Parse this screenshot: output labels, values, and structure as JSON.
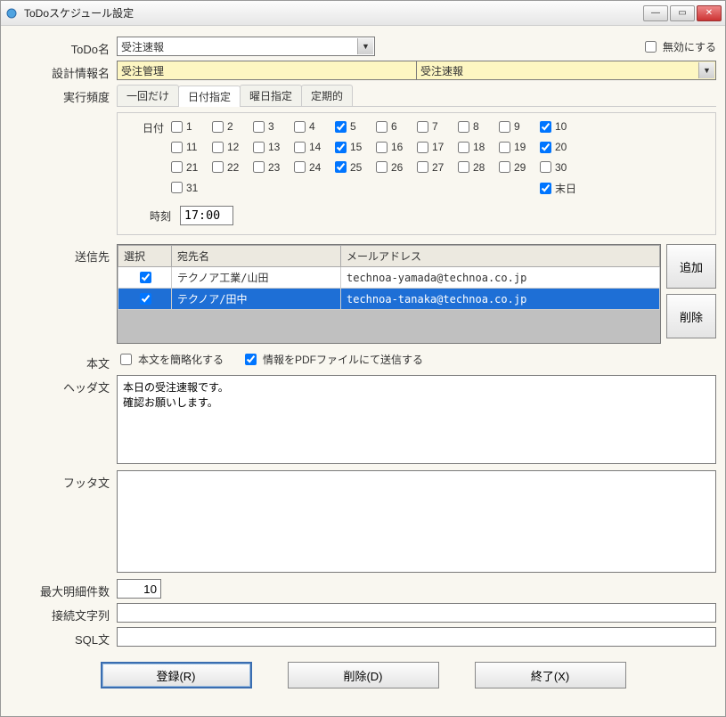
{
  "window": {
    "title": "ToDoスケジュール設定",
    "icon": "todo-icon"
  },
  "fields": {
    "todo_name_label": "ToDo名",
    "todo_name_value": "受注速報",
    "disable_label": "無効にする",
    "disable_checked": false,
    "design_info_label": "設計情報名",
    "design_info_left": "受注管理",
    "design_info_right": "受注速報",
    "frequency_label": "実行頻度",
    "tabs": [
      {
        "label": "一回だけ"
      },
      {
        "label": "日付指定"
      },
      {
        "label": "曜日指定"
      },
      {
        "label": "定期的"
      }
    ],
    "active_tab": 1,
    "date_sub_label": "日付",
    "dates": [
      {
        "n": 1,
        "c": false
      },
      {
        "n": 2,
        "c": false
      },
      {
        "n": 3,
        "c": false
      },
      {
        "n": 4,
        "c": false
      },
      {
        "n": 5,
        "c": true
      },
      {
        "n": 6,
        "c": false
      },
      {
        "n": 7,
        "c": false
      },
      {
        "n": 8,
        "c": false
      },
      {
        "n": 9,
        "c": false
      },
      {
        "n": 10,
        "c": true
      },
      {
        "n": 11,
        "c": false
      },
      {
        "n": 12,
        "c": false
      },
      {
        "n": 13,
        "c": false
      },
      {
        "n": 14,
        "c": false
      },
      {
        "n": 15,
        "c": true
      },
      {
        "n": 16,
        "c": false
      },
      {
        "n": 17,
        "c": false
      },
      {
        "n": 18,
        "c": false
      },
      {
        "n": 19,
        "c": false
      },
      {
        "n": 20,
        "c": true
      },
      {
        "n": 21,
        "c": false
      },
      {
        "n": 22,
        "c": false
      },
      {
        "n": 23,
        "c": false
      },
      {
        "n": 24,
        "c": false
      },
      {
        "n": 25,
        "c": true
      },
      {
        "n": 26,
        "c": false
      },
      {
        "n": 27,
        "c": false
      },
      {
        "n": 28,
        "c": false
      },
      {
        "n": 29,
        "c": false
      },
      {
        "n": 30,
        "c": false
      },
      {
        "n": 31,
        "c": false
      }
    ],
    "last_day_label": "末日",
    "last_day_checked": true,
    "time_sub_label": "時刻",
    "time_value": "17:00",
    "dest_label": "送信先",
    "dest_headers": {
      "select": "選択",
      "name": "宛先名",
      "email": "メールアドレス"
    },
    "dest_rows": [
      {
        "selected": false,
        "checked": true,
        "name": "テクノア工業/山田",
        "email": "technoa-yamada@technoa.co.jp"
      },
      {
        "selected": true,
        "checked": true,
        "name": "テクノア/田中",
        "email": "technoa-tanaka@technoa.co.jp"
      }
    ],
    "btn_add": "追加",
    "btn_del": "削除",
    "body_label": "本文",
    "body_simplify_label": "本文を簡略化する",
    "body_simplify_checked": false,
    "body_pdf_label": "情報をPDFファイルにて送信する",
    "body_pdf_checked": true,
    "header_label": "ヘッダ文",
    "header_text": "本日の受注速報です。\n確認お願いします。",
    "footer_label": "フッタ文",
    "footer_text": "",
    "max_rows_label": "最大明細件数",
    "max_rows_value": "10",
    "conn_str_label": "接続文字列",
    "conn_str_value": "",
    "sql_label": "SQL文",
    "sql_value": "",
    "btn_register": "登録(R)",
    "btn_delete": "削除(D)",
    "btn_exit": "終了(X)"
  }
}
